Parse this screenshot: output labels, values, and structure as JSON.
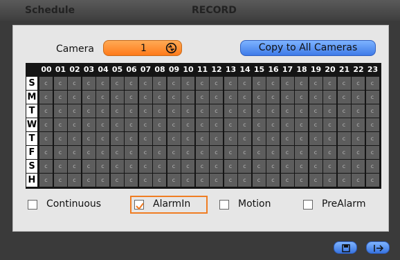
{
  "window": {
    "section": "Schedule",
    "title": "RECORD"
  },
  "camera": {
    "label": "Camera",
    "value": "1",
    "copy_button": "Copy to All Cameras"
  },
  "grid": {
    "hours": [
      "00",
      "01",
      "02",
      "03",
      "04",
      "05",
      "06",
      "07",
      "08",
      "09",
      "10",
      "11",
      "12",
      "13",
      "14",
      "15",
      "16",
      "17",
      "18",
      "19",
      "20",
      "21",
      "22",
      "23"
    ],
    "days": [
      "S",
      "M",
      "T",
      "W",
      "T",
      "F",
      "S",
      "H"
    ],
    "cell_mark": "c",
    "rows": [
      [
        "c",
        "c",
        "c",
        "c",
        "c",
        "c",
        "c",
        "c",
        "c",
        "c",
        "c",
        "c",
        "c",
        "c",
        "c",
        "c",
        "c",
        "c",
        "c",
        "c",
        "c",
        "c",
        "c",
        "c"
      ],
      [
        "c",
        "c",
        "c",
        "c",
        "c",
        "c",
        "c",
        "c",
        "c",
        "c",
        "c",
        "c",
        "c",
        "c",
        "c",
        "c",
        "c",
        "c",
        "c",
        "c",
        "c",
        "c",
        "c",
        "c"
      ],
      [
        "c",
        "c",
        "c",
        "c",
        "c",
        "c",
        "c",
        "c",
        "c",
        "c",
        "c",
        "c",
        "c",
        "c",
        "c",
        "c",
        "c",
        "c",
        "c",
        "c",
        "c",
        "c",
        "c",
        "c"
      ],
      [
        "c",
        "c",
        "c",
        "c",
        "c",
        "c",
        "c",
        "c",
        "c",
        "c",
        "c",
        "c",
        "c",
        "c",
        "c",
        "c",
        "c",
        "c",
        "c",
        "c",
        "c",
        "c",
        "c",
        "c"
      ],
      [
        "c",
        "c",
        "c",
        "c",
        "c",
        "c",
        "c",
        "c",
        "c",
        "c",
        "c",
        "c",
        "c",
        "c",
        "c",
        "c",
        "c",
        "c",
        "c",
        "c",
        "c",
        "c",
        "c",
        "c"
      ],
      [
        "c",
        "c",
        "c",
        "c",
        "c",
        "c",
        "c",
        "c",
        "c",
        "c",
        "c",
        "c",
        "c",
        "c",
        "c",
        "c",
        "c",
        "c",
        "c",
        "c",
        "c",
        "c",
        "c",
        "c"
      ],
      [
        "c",
        "c",
        "c",
        "c",
        "c",
        "c",
        "c",
        "c",
        "c",
        "c",
        "c",
        "c",
        "c",
        "c",
        "c",
        "c",
        "c",
        "c",
        "c",
        "c",
        "c",
        "c",
        "c",
        "c"
      ],
      [
        "c",
        "c",
        "c",
        "c",
        "c",
        "c",
        "c",
        "c",
        "c",
        "c",
        "c",
        "c",
        "c",
        "c",
        "c",
        "c",
        "c",
        "c",
        "c",
        "c",
        "c",
        "c",
        "c",
        "c"
      ]
    ]
  },
  "modes": [
    {
      "label": "Continuous",
      "checked": false
    },
    {
      "label": "AlarmIn",
      "checked": true
    },
    {
      "label": "Motion",
      "checked": false
    },
    {
      "label": "PreAlarm",
      "checked": false
    }
  ],
  "footer": {
    "save_icon": "save-icon",
    "exit_icon": "exit-icon"
  },
  "colors": {
    "accent_orange": "#ff8a2a",
    "accent_blue": "#5a94f5",
    "grid_cell": "#5d5d5d"
  }
}
